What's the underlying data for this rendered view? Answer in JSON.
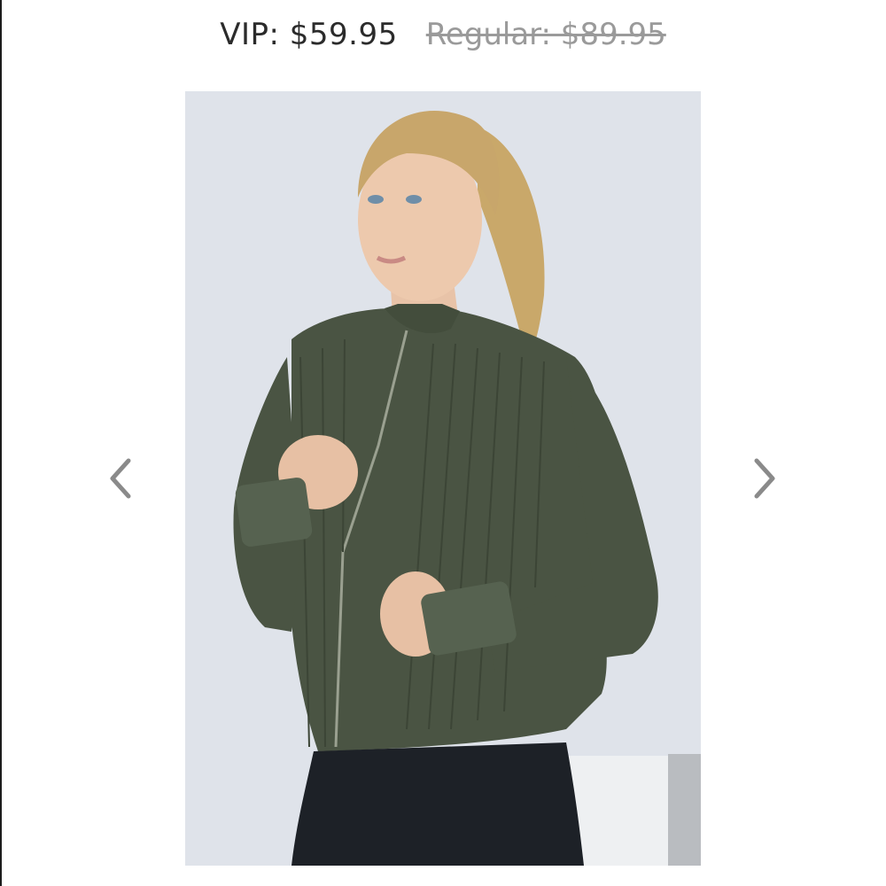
{
  "pricing": {
    "vip": "VIP: $59.95",
    "regular": "Regular: $89.95"
  },
  "gallery": {
    "prev_icon": "chevron-left-icon",
    "next_icon": "chevron-right-icon",
    "image_alt": "product-photo"
  },
  "colors": {
    "text_dark": "#2b2b2b",
    "text_muted": "#9a9a9a",
    "jacket_olive": "#4a5443",
    "arrow_gray": "#8a8a8a"
  }
}
